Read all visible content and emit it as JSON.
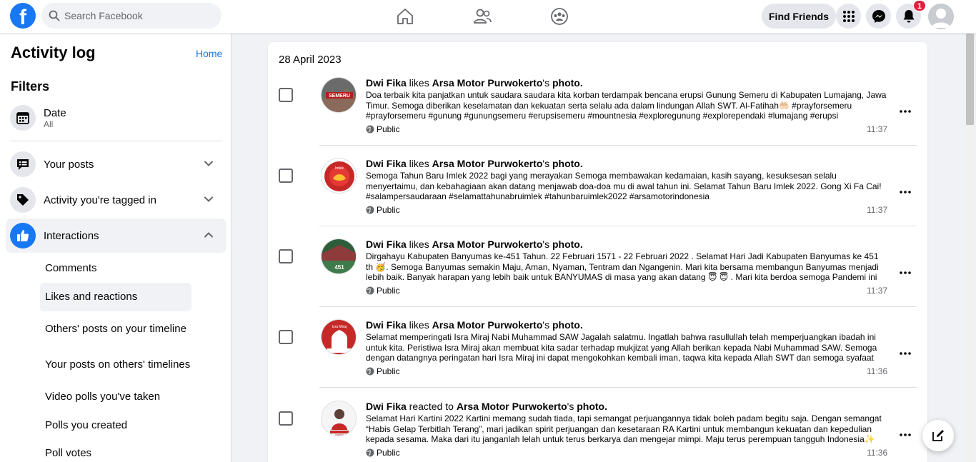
{
  "topbar": {
    "logo_letter": "f",
    "search_placeholder": "Search Facebook",
    "find_friends": "Find Friends",
    "notification_count": "1",
    "icons": [
      "home-icon",
      "friends-icon",
      "groups-icon",
      "menu-grid-icon",
      "messenger-icon",
      "bell-icon"
    ]
  },
  "sidebar": {
    "title": "Activity log",
    "home_link": "Home",
    "filters_heading": "Filters",
    "date_filter": {
      "label": "Date",
      "value": "All"
    },
    "sections": [
      {
        "label": "Your posts",
        "icon": "post-icon"
      },
      {
        "label": "Activity you're tagged in",
        "icon": "tag-icon"
      },
      {
        "label": "Interactions",
        "icon": "thumbs-up-icon"
      }
    ],
    "sub_items": [
      "Comments",
      "Likes and reactions",
      "Others' posts on your timeline",
      "Your posts on others' timelines",
      "Video polls you've taken",
      "Polls you created",
      "Poll votes"
    ]
  },
  "main": {
    "date_heading": "28 April 2023",
    "entries": [
      {
        "actor": "Dwi Fika",
        "verb": " likes ",
        "target": "Arsa Motor Purwokerto",
        "suffix_target": "'s ",
        "object": "photo.",
        "body": "Doa terbaik kita panjatkan untuk saudara saudara kita korban terdampak bencana erupsi Gunung Semeru di Kabupaten Lumajang, Jawa Timur. Semoga diberikan keselamatan dan kekuatan serta selalu ada dalam lindungan Allah SWT. Al-Fatihah🤲🏻 #prayforsemeru #prayforsemeru #gunung #gunungsemeru #erupsisemeru #mountnesia #exploregunung #explorependaki #lumajang #erupsi #semeruerupsi...",
        "privacy": "Public",
        "time": "11:37",
        "thumb_text": "SEMERU"
      },
      {
        "actor": "Dwi Fika",
        "verb": " likes ",
        "target": "Arsa Motor Purwokerto",
        "suffix_target": "'s ",
        "object": "photo.",
        "body": "Semoga Tahun Baru Imlek 2022 bagi yang merayakan Semoga membawakan kedamaian, kasih sayang, kesuksesan selalu menyertaimu, dan kebahagiaan akan datang menjawab doa-doa mu di awal tahun ini. Selamat Tahun Baru Imlek 2022. Gong Xi Fa Cai! #salampersaudaraan #selamattahunabruimlek #tahunbaruimlek2022 #arsamotorindonesia",
        "privacy": "Public",
        "time": "11:37",
        "thumb_text": "Imlek"
      },
      {
        "actor": "Dwi Fika",
        "verb": " likes ",
        "target": "Arsa Motor Purwokerto",
        "suffix_target": "'s ",
        "object": "photo.",
        "body": "Dirgahayu Kabupaten Banyumas ke-451 Tahun. 22 Februari 1571 - 22 Februari 2022 . Selamat Hari Jadi Kabupaten Banyumas ke 451 th 🥳. Semoga Banyumas semakin Maju, Aman, Nyaman, Tentram dan Ngangenin. Mari kita bersama membangun Banyumas menjadi lebih baik. Banyak harapan yang lebih baik untuk BANYUMAS di masa yang akan datang 😇 😇 . Mari kita berdoa semoga Pandemi ini cepat berlalu,...",
        "privacy": "Public",
        "time": "11:37",
        "thumb_text": "451"
      },
      {
        "actor": "Dwi Fika",
        "verb": " likes ",
        "target": "Arsa Motor Purwokerto",
        "suffix_target": "'s ",
        "object": "photo.",
        "body": "Selamat memperingati Isra Miraj Nabi Muhammad SAW Jagalah salatmu. Ingatlah bahwa rasullullah telah memperjuangkan ibadah ini untuk kita. Peristiwa Isra Miraj akan membuat kita sadar terhadap mukjizat yang Allah berikan kepada Nabi Muhammad SAW. Semoga dengan datangnya peringatan hari Isra Miraj ini dapat mengokohkan kembali iman, taqwa kita kepada Allah SWT dan semoga syafaat Nabi...",
        "privacy": "Public",
        "time": "11:36",
        "thumb_text": "Isra Miraj"
      },
      {
        "actor": "Dwi Fika",
        "verb": " reacted to ",
        "target": "Arsa Motor Purwokerto",
        "suffix_target": "'s ",
        "object": "photo.",
        "body": "Selamat Hari Kartini 2022 Kartini memang sudah tiada, tapi semangat perjuangannya tidak boleh padam begitu saja. Dengan semangat “Habis Gelap Terbitlah Terang”, mari jadikan spirit perjuangan dan kesetaraan RA Kartini untuk membangun kekuatan dan kepedulian kepada sesama. Maka dari itu janganlah lelah untuk terus berkarya dan mengejar mimpi. Maju terus perempuan tangguh Indonesia✨ #harikartini...",
        "privacy": "Public",
        "time": "11:36",
        "thumb_text": "Kartini"
      }
    ]
  },
  "colors": {
    "brand": "#1877f2",
    "badge": "#e41e3f"
  }
}
